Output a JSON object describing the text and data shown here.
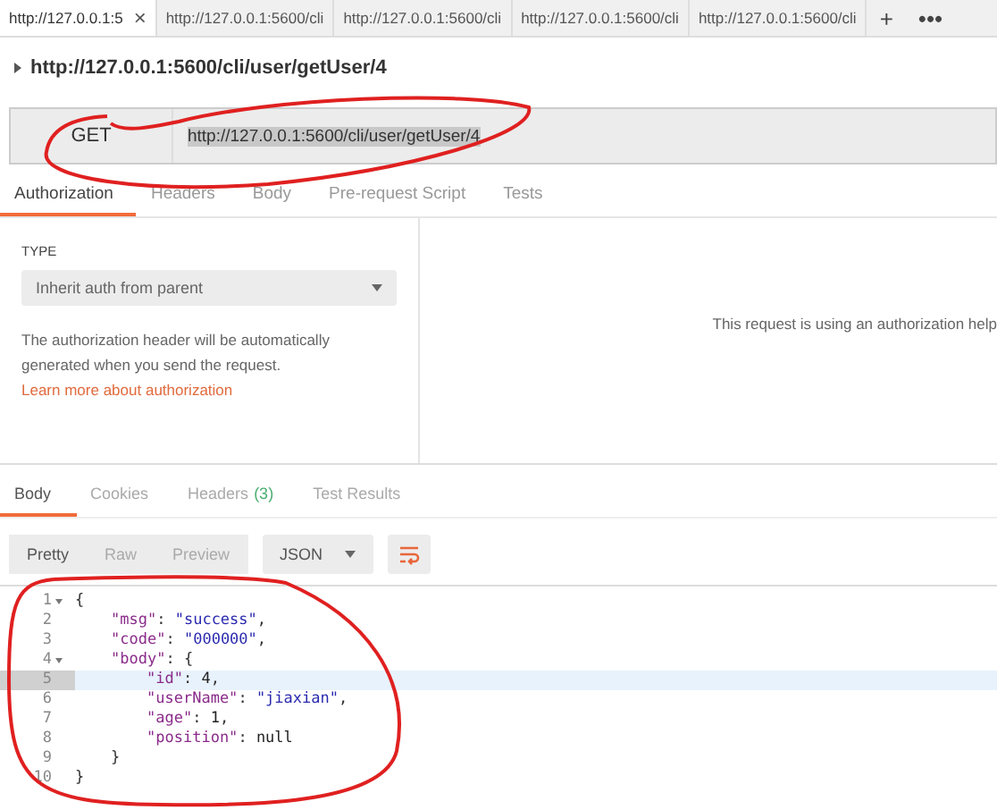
{
  "tabs": [
    {
      "label": "http://127.0.0.1:5",
      "selected": true,
      "close": "×"
    },
    {
      "label": "http://127.0.0.1:5600/cli",
      "selected": false
    },
    {
      "label": "http://127.0.0.1:5600/cli",
      "selected": false
    },
    {
      "label": "http://127.0.0.1:5600/cli",
      "selected": false
    },
    {
      "label": "http://127.0.0.1:5600/cli",
      "selected": false
    }
  ],
  "new_tab": "+",
  "more": "•••",
  "request": {
    "title": "http://127.0.0.1:5600/cli/user/getUser/4",
    "method": "GET",
    "url": "http://127.0.0.1:5600/cli/user/getUser/4"
  },
  "request_tabs": [
    {
      "label": "Authorization",
      "selected": true
    },
    {
      "label": "Headers",
      "selected": false
    },
    {
      "label": "Body",
      "selected": false
    },
    {
      "label": "Pre-request Script",
      "selected": false
    },
    {
      "label": "Tests",
      "selected": false
    }
  ],
  "auth": {
    "type_label": "TYPE",
    "type_value": "Inherit auth from parent",
    "description": "The authorization header will be automatically generated when you send the request.",
    "link": "Learn more about authorization",
    "info": "This request is using an authorization help"
  },
  "response_tabs": [
    {
      "label": "Body",
      "selected": true
    },
    {
      "label": "Cookies",
      "selected": false
    },
    {
      "label": "Headers",
      "count": "(3)",
      "selected": false
    },
    {
      "label": "Test Results",
      "selected": false
    }
  ],
  "view_modes": [
    {
      "label": "Pretty",
      "selected": true
    },
    {
      "label": "Raw",
      "selected": false
    },
    {
      "label": "Preview",
      "selected": false
    }
  ],
  "format": "JSON",
  "code_lines": [
    {
      "number": "1",
      "foldable": true,
      "highlighted": false,
      "tokens": [
        {
          "kind": "punct",
          "text": "{"
        }
      ]
    },
    {
      "number": "2",
      "foldable": false,
      "highlighted": false,
      "tokens": [
        {
          "kind": "key",
          "text": "\"msg\""
        },
        {
          "kind": "punct",
          "text": ": "
        },
        {
          "kind": "string",
          "text": "\"success\""
        },
        {
          "kind": "punct",
          "text": ","
        }
      ]
    },
    {
      "number": "3",
      "foldable": false,
      "highlighted": false,
      "tokens": [
        {
          "kind": "key",
          "text": "\"code\""
        },
        {
          "kind": "punct",
          "text": ": "
        },
        {
          "kind": "string",
          "text": "\"000000\""
        },
        {
          "kind": "punct",
          "text": ","
        }
      ]
    },
    {
      "number": "4",
      "foldable": true,
      "highlighted": false,
      "tokens": [
        {
          "kind": "key",
          "text": "\"body\""
        },
        {
          "kind": "punct",
          "text": ": {"
        }
      ]
    },
    {
      "number": "5",
      "foldable": false,
      "highlighted": true,
      "tokens": [
        {
          "kind": "key",
          "text": "\"id\""
        },
        {
          "kind": "punct",
          "text": ": "
        },
        {
          "kind": "number",
          "text": "4"
        },
        {
          "kind": "punct",
          "text": ","
        }
      ]
    },
    {
      "number": "6",
      "foldable": false,
      "highlighted": false,
      "tokens": [
        {
          "kind": "key",
          "text": "\"userName\""
        },
        {
          "kind": "punct",
          "text": ": "
        },
        {
          "kind": "string",
          "text": "\"jiaxian\""
        },
        {
          "kind": "punct",
          "text": ","
        }
      ]
    },
    {
      "number": "7",
      "foldable": false,
      "highlighted": false,
      "tokens": [
        {
          "kind": "key",
          "text": "\"age\""
        },
        {
          "kind": "punct",
          "text": ": "
        },
        {
          "kind": "number",
          "text": "1"
        },
        {
          "kind": "punct",
          "text": ","
        }
      ]
    },
    {
      "number": "8",
      "foldable": false,
      "highlighted": false,
      "tokens": [
        {
          "kind": "key",
          "text": "\"position\""
        },
        {
          "kind": "punct",
          "text": ": "
        },
        {
          "kind": "null",
          "text": "null"
        }
      ]
    },
    {
      "number": "9",
      "foldable": false,
      "highlighted": false,
      "tokens": [
        {
          "kind": "punct",
          "text": "}"
        }
      ]
    },
    {
      "number": "10",
      "foldable": false,
      "highlighted": false,
      "tokens": [
        {
          "kind": "punct",
          "text": "}"
        }
      ]
    }
  ]
}
